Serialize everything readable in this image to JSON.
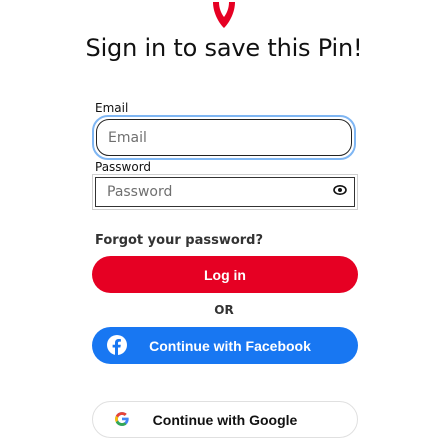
{
  "header": {
    "logo_icon": "pinterest-heart-icon",
    "title": "Sign in to save this Pin!"
  },
  "form": {
    "email_label": "Email",
    "email_placeholder": "Email",
    "password_label": "Password",
    "password_placeholder": "Password",
    "password_toggle_icon": "eye-icon",
    "forgot_link": "Forgot your password?",
    "login_button": "Log in",
    "or_text": "OR"
  },
  "social": {
    "facebook_button": "Continue with Facebook",
    "facebook_icon": "facebook-icon",
    "google_button": "Continue with Google",
    "google_icon": "google-icon"
  },
  "colors": {
    "brand_red": "#e60023",
    "facebook_blue": "#1877f2",
    "focus_ring": "#7fb6f3"
  }
}
